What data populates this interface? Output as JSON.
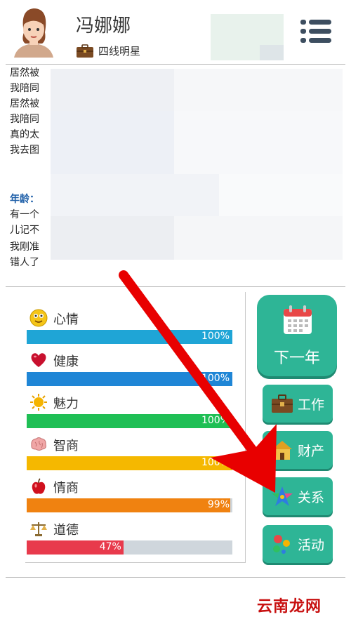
{
  "header": {
    "player_name": "冯娜娜",
    "title": "四线明星"
  },
  "log": {
    "lines": [
      "居然被",
      "我陪同",
      "居然被",
      "我陪同",
      "真的太",
      "我去图",
      "年龄：",
      "有一个",
      "儿记不",
      "我刚准",
      "错人了"
    ]
  },
  "stats": [
    {
      "label": "心情",
      "value": 100,
      "display": "100%",
      "color": "#1fa5d6",
      "icon": "smiley-icon"
    },
    {
      "label": "健康",
      "value": 100,
      "display": "100%",
      "color": "#1f86d6",
      "icon": "heart-icon"
    },
    {
      "label": "魅力",
      "value": 100,
      "display": "100%",
      "color": "#1fbf55",
      "icon": "sun-icon"
    },
    {
      "label": "智商",
      "value": 100,
      "display": "100%",
      "color": "#f5b800",
      "icon": "brain-icon"
    },
    {
      "label": "情商",
      "value": 99,
      "display": "99%",
      "color": "#f08210",
      "icon": "apple-icon"
    },
    {
      "label": "道德",
      "value": 47,
      "display": "47%",
      "color": "#e83a4c",
      "icon": "scales-icon"
    }
  ],
  "buttons": {
    "next_year": "下一年",
    "work": "工作",
    "property": "财产",
    "relations": "关系",
    "activity": "活动"
  },
  "watermark": "云南龙网"
}
